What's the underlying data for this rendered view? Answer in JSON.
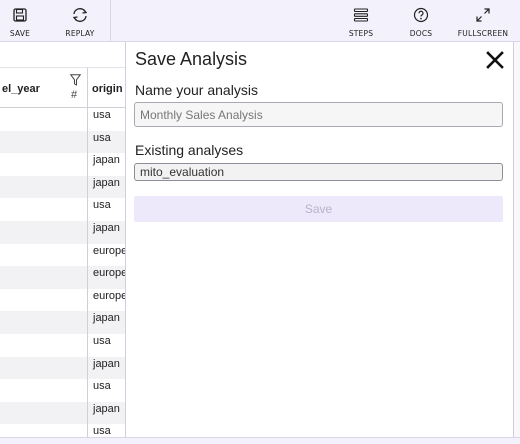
{
  "toolbar": {
    "left": [
      {
        "label": "SAVE",
        "icon": "save-icon"
      },
      {
        "label": "REPLAY",
        "icon": "replay-icon"
      }
    ],
    "right": [
      {
        "label": "STEPS",
        "icon": "steps-icon"
      },
      {
        "label": "DOCS",
        "icon": "docs-icon"
      },
      {
        "label": "FULLSCREEN",
        "icon": "fullscreen-icon"
      }
    ]
  },
  "grid": {
    "columns": [
      "el_year",
      "origin"
    ],
    "year_type_icon": "#",
    "origin_values": [
      "usa",
      "usa",
      "japan",
      "japan",
      "usa",
      "japan",
      "europe",
      "europe",
      "europe",
      "japan",
      "usa",
      "japan",
      "usa",
      "japan",
      "usa"
    ]
  },
  "panel": {
    "title": "Save Analysis",
    "name_label": "Name your analysis",
    "name_placeholder": "Monthly Sales Analysis",
    "existing_label": "Existing analyses",
    "existing_value": "mito_evaluation",
    "save_button": "Save"
  },
  "colors": {
    "toolbar_bg": "#f3f1fb",
    "save_button_bg": "#ede9fb",
    "save_button_text": "#b7b4c9"
  }
}
